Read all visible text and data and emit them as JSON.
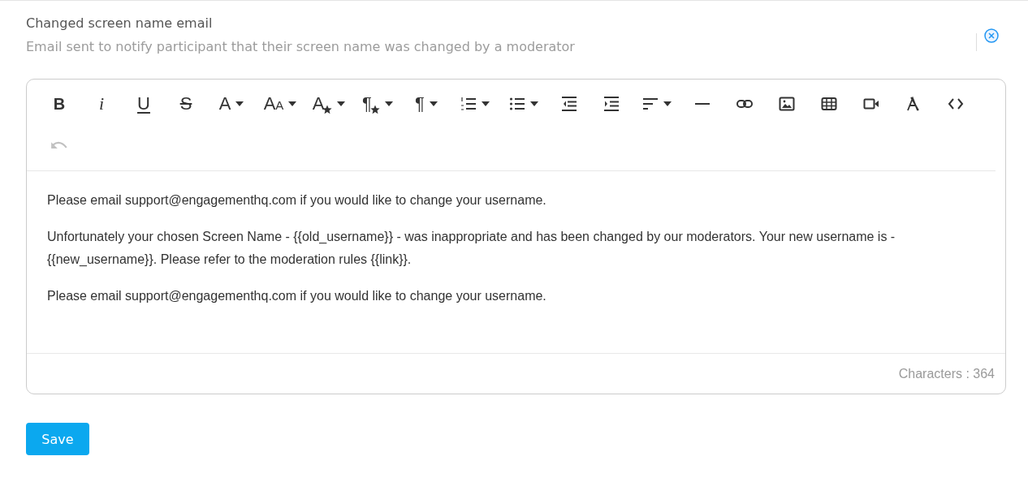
{
  "header": {
    "title": "Changed screen name email",
    "description": "Email sent to notify participant that their screen name was changed by a moderator"
  },
  "toolbar": [
    {
      "kind": "bold",
      "glyph": "B",
      "dropdown": false
    },
    {
      "kind": "italic",
      "glyph": "i",
      "dropdown": false
    },
    {
      "kind": "underline",
      "glyph": "U",
      "dropdown": false
    },
    {
      "kind": "strike",
      "glyph": "S",
      "dropdown": false
    },
    {
      "kind": "glyph",
      "glyph": "A",
      "dropdown": true
    },
    {
      "kind": "sizes",
      "glyph": "AA",
      "dropdown": true
    },
    {
      "kind": "starred",
      "glyph": "A",
      "dropdown": true
    },
    {
      "kind": "starred",
      "glyph": "¶",
      "dropdown": true
    },
    {
      "kind": "glyph",
      "glyph": "¶",
      "dropdown": true
    },
    {
      "kind": "olist",
      "dropdown": true
    },
    {
      "kind": "ulist",
      "dropdown": true
    },
    {
      "kind": "outdent",
      "dropdown": false
    },
    {
      "kind": "indent",
      "dropdown": false
    },
    {
      "kind": "align",
      "dropdown": true
    },
    {
      "kind": "rule",
      "dropdown": false
    },
    {
      "kind": "link",
      "dropdown": false
    },
    {
      "kind": "image",
      "dropdown": false
    },
    {
      "kind": "table",
      "dropdown": false
    },
    {
      "kind": "video",
      "dropdown": false
    },
    {
      "kind": "clear",
      "dropdown": false
    },
    {
      "kind": "code",
      "dropdown": false
    }
  ],
  "toolbar_row2": [
    {
      "kind": "undo",
      "disabled": true
    }
  ],
  "body": [
    "Please email support@engagementhq.com if you would like to change your username.",
    "Unfortunately your chosen Screen Name - {{old_username}} - was inappropriate and has been changed by our moderators. Your new username is - {{new_username}}. Please refer to the moderation rules {{link}}.",
    "Please email support@engagementhq.com if you would like to change your username."
  ],
  "footer": {
    "characters": "Characters : 364"
  },
  "save_button": "Save"
}
